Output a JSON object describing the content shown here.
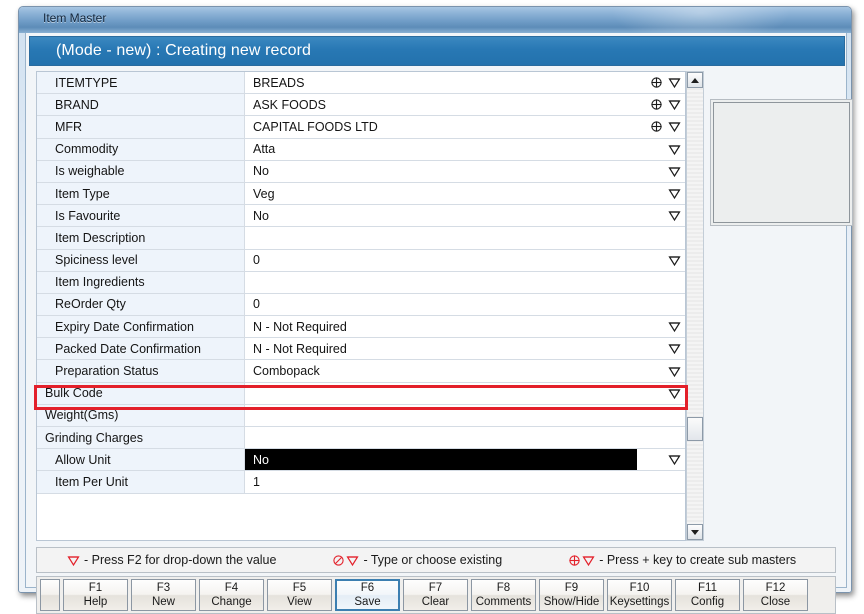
{
  "window": {
    "os_title": "Item Master",
    "mode_header": "(Mode - new) : Creating new record"
  },
  "form": {
    "rows": [
      {
        "label": "ITEMTYPE",
        "value": "BREADS",
        "icons": [
          "plus-circle-icon",
          "dropdown-triangle-icon"
        ],
        "indent": "normal",
        "selected": false
      },
      {
        "label": "BRAND",
        "value": "ASK FOODS",
        "icons": [
          "plus-circle-icon",
          "dropdown-triangle-icon"
        ],
        "indent": "normal",
        "selected": false
      },
      {
        "label": "MFR",
        "value": "CAPITAL FOODS LTD",
        "icons": [
          "plus-circle-icon",
          "dropdown-triangle-icon"
        ],
        "indent": "normal",
        "selected": false
      },
      {
        "label": "Commodity",
        "value": "Atta",
        "icons": [
          "dropdown-triangle-icon"
        ],
        "indent": "normal",
        "selected": false
      },
      {
        "label": "Is weighable",
        "value": "No",
        "icons": [
          "dropdown-triangle-icon"
        ],
        "indent": "normal",
        "selected": false
      },
      {
        "label": "Item Type",
        "value": "Veg",
        "icons": [
          "dropdown-triangle-icon"
        ],
        "indent": "normal",
        "selected": false
      },
      {
        "label": "Is Favourite",
        "value": "No",
        "icons": [
          "dropdown-triangle-icon"
        ],
        "indent": "normal",
        "selected": false
      },
      {
        "label": "Item Description",
        "value": "",
        "icons": [],
        "indent": "normal",
        "selected": false
      },
      {
        "label": "Spiciness level",
        "value": "0",
        "icons": [
          "dropdown-triangle-icon"
        ],
        "indent": "normal",
        "selected": false
      },
      {
        "label": "Item Ingredients",
        "value": "",
        "icons": [],
        "indent": "normal",
        "selected": false
      },
      {
        "label": "ReOrder Qty",
        "value": "0",
        "icons": [],
        "indent": "normal",
        "selected": false
      },
      {
        "label": "Expiry Date Confirmation",
        "value": "N - Not Required",
        "icons": [
          "dropdown-triangle-icon"
        ],
        "indent": "normal",
        "selected": false
      },
      {
        "label": "Packed Date Confirmation",
        "value": "N - Not Required",
        "icons": [
          "dropdown-triangle-icon"
        ],
        "indent": "normal",
        "selected": false
      },
      {
        "label": "Preparation Status",
        "value": "Combopack",
        "icons": [
          "dropdown-triangle-icon"
        ],
        "indent": "normal",
        "selected": false
      },
      {
        "label": "Bulk Code",
        "value": "",
        "icons": [
          "dropdown-triangle-icon"
        ],
        "indent": "flush",
        "selected": false
      },
      {
        "label": "Weight(Gms)",
        "value": "",
        "icons": [],
        "indent": "flush",
        "selected": false
      },
      {
        "label": "Grinding Charges",
        "value": "",
        "icons": [],
        "indent": "flush",
        "selected": false
      },
      {
        "label": "Allow Unit",
        "value": "No",
        "icons": [
          "dropdown-triangle-icon"
        ],
        "indent": "normal",
        "selected": true
      },
      {
        "label": "Item Per Unit",
        "value": "1",
        "icons": [],
        "indent": "normal",
        "selected": false
      }
    ],
    "highlight": {
      "row_label": "Preparation Status",
      "color": "#e3202a"
    }
  },
  "scrollbar": {
    "up_arrow": "scroll-up-icon",
    "down_arrow": "scroll-down-icon"
  },
  "image_preview": {
    "name": "item-image-placeholder",
    "value": ""
  },
  "legend": {
    "items": [
      {
        "glyphs": [
          "dropdown-triangle-icon"
        ],
        "text": "- Press F2 for drop-down the value"
      },
      {
        "glyphs": [
          "no-entry-icon",
          "dropdown-triangle-icon"
        ],
        "text": "- Type or choose existing"
      },
      {
        "glyphs": [
          "plus-circle-icon",
          "dropdown-triangle-icon"
        ],
        "text": "- Press + key to create sub masters"
      }
    ],
    "color": "#e3202a"
  },
  "function_keys": [
    {
      "key": "F1",
      "label": "Help",
      "active": false
    },
    {
      "key": "F3",
      "label": "New",
      "active": false
    },
    {
      "key": "F4",
      "label": "Change",
      "active": false
    },
    {
      "key": "F5",
      "label": "View",
      "active": false
    },
    {
      "key": "F6",
      "label": "Save",
      "active": true
    },
    {
      "key": "F7",
      "label": "Clear",
      "active": false
    },
    {
      "key": "F8",
      "label": "Comments",
      "active": false
    },
    {
      "key": "F9",
      "label": "Show/Hide",
      "active": false
    },
    {
      "key": "F10",
      "label": "Keysettings",
      "active": false
    },
    {
      "key": "F11",
      "label": "Config",
      "active": false
    },
    {
      "key": "F12",
      "label": "Close",
      "active": false
    }
  ],
  "colors": {
    "header_blue": "#2878b4",
    "highlight_red": "#e3202a",
    "selection_black": "#000000",
    "label_bg": "#eef4fb"
  }
}
